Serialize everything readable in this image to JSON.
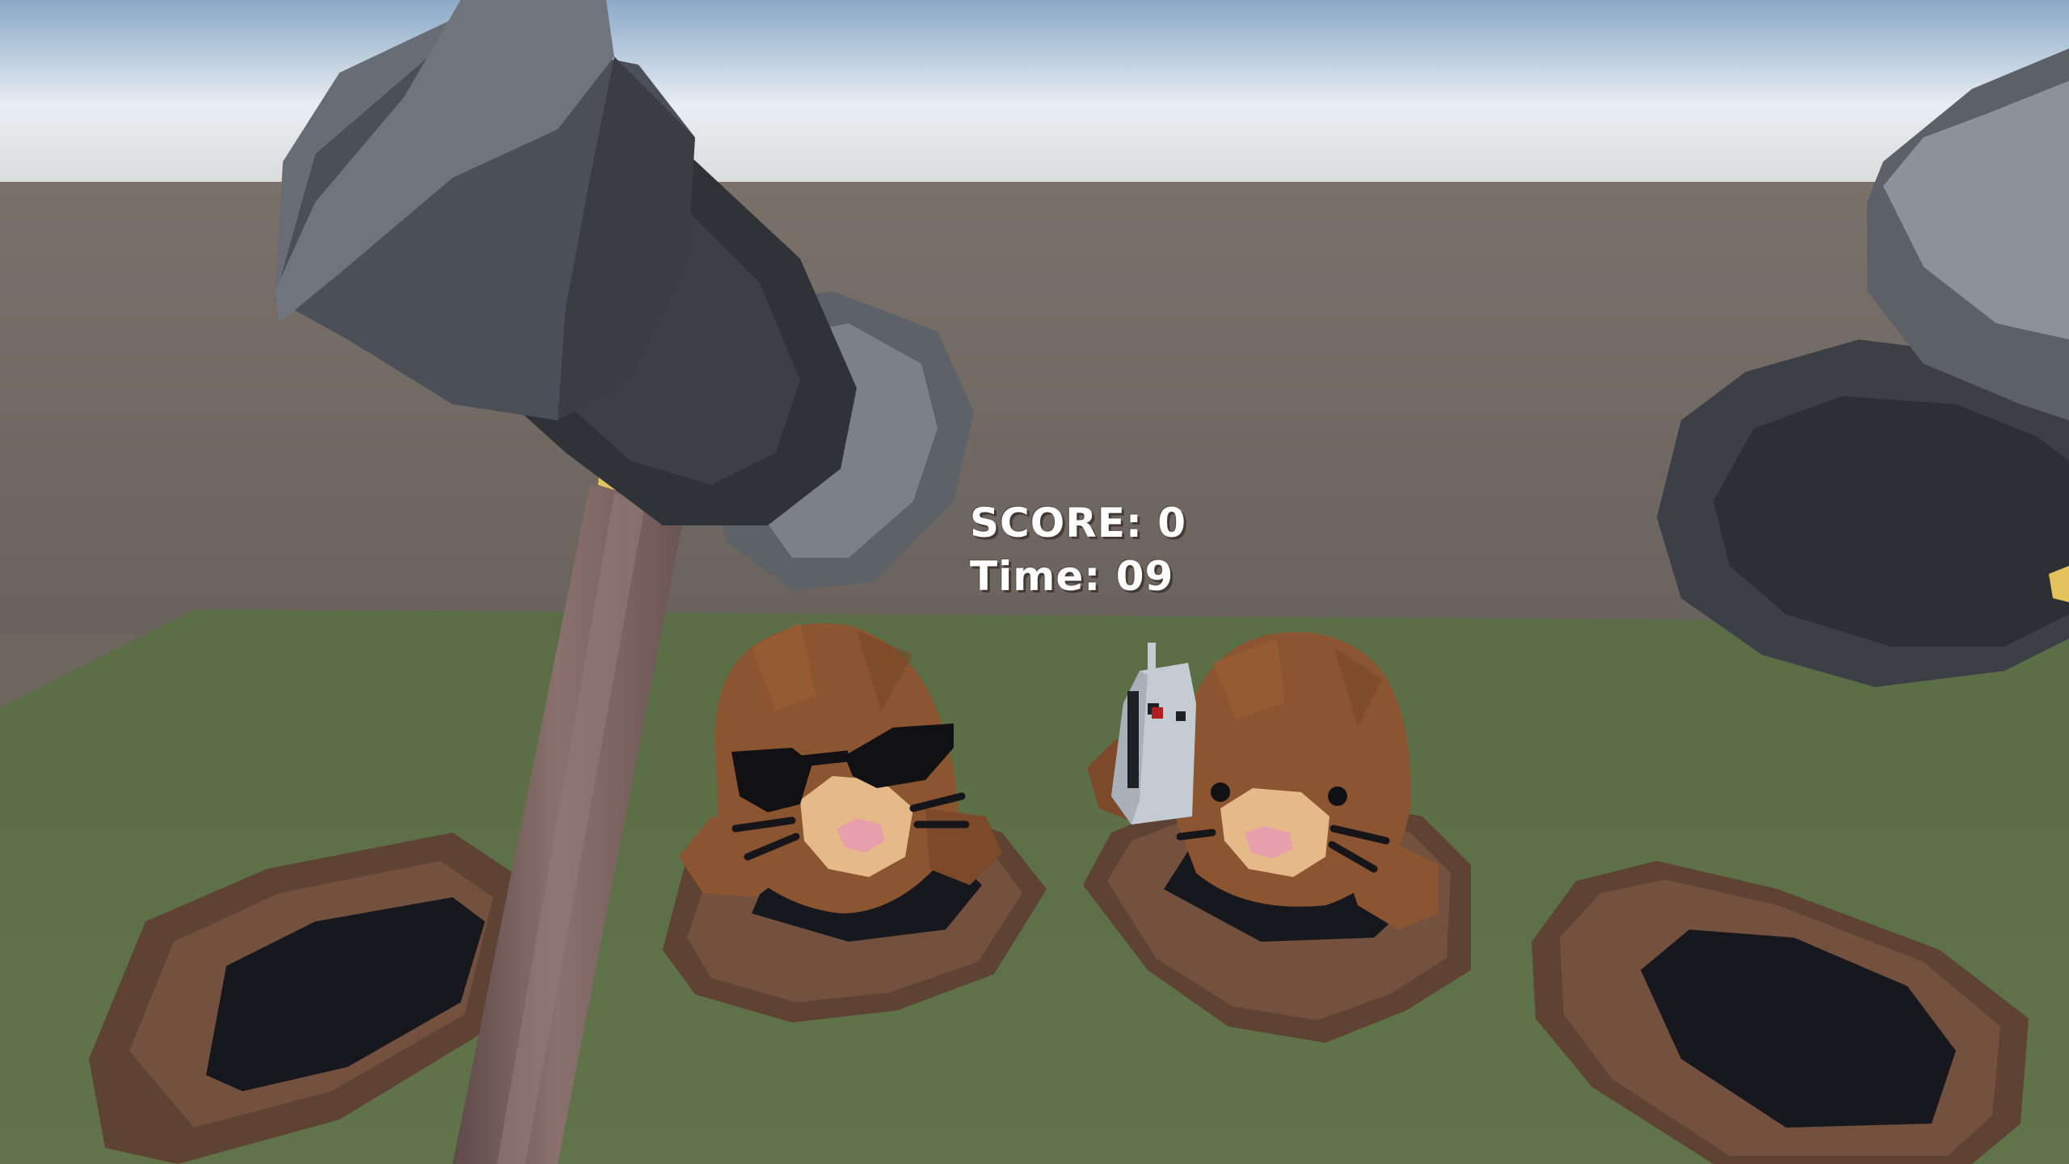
{
  "hud": {
    "score_label": "SCORE:",
    "score_value": "0",
    "time_label": "Time:",
    "time_value": "09"
  },
  "scene": {
    "sky_color": "#e7eef4",
    "horizon_color": "#6f6660",
    "grass_color": "#5f7149",
    "hole_rim_color": "#6b4b3a",
    "hole_inner_color": "#18191e",
    "mole_color": "#8a5530",
    "mole_muzzle_color": "#e6b988",
    "mole_nose_color": "#e7a0ab",
    "hammer_head_color": "#4b4f57",
    "hammer_handle_color": "#7d6461",
    "hammer_collar_color": "#e3c35d",
    "mole_count": 2,
    "hole_count": 4,
    "left_mole_accessory": "sunglasses-icon",
    "right_mole_accessory": "boombox-icon"
  }
}
